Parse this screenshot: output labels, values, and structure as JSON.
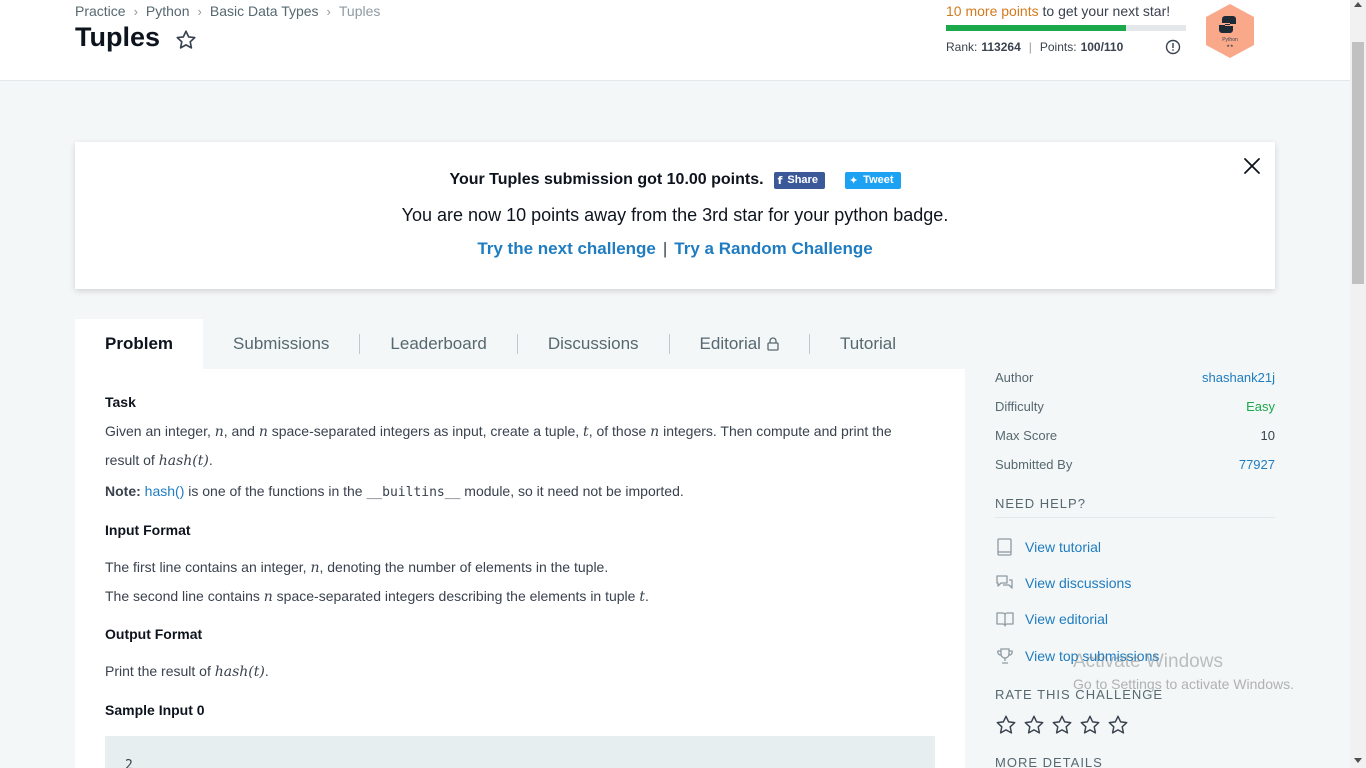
{
  "header": {
    "breadcrumb": [
      "Practice",
      "Python",
      "Basic Data Types",
      "Tuples"
    ],
    "title": "Tuples",
    "points_highlight": "10 more points",
    "points_rest": " to get your next star!",
    "progress_fraction": 0.75,
    "rank_label": "Rank:",
    "rank_value": "113264",
    "points_label": "Points:",
    "points_value": "100/110",
    "badge_label": "Python",
    "badge_stars": "★★"
  },
  "banner": {
    "message": "Your Tuples submission got 10.00 points.",
    "share_label": "Share",
    "tweet_label": "Tweet",
    "subtitle": "You are now 10 points away from the 3rd star for your python badge.",
    "next_link": "Try the next challenge",
    "separator": "|",
    "random_link": "Try a Random Challenge"
  },
  "tabs": [
    "Problem",
    "Submissions",
    "Leaderboard",
    "Discussions",
    "Editorial",
    "Tutorial"
  ],
  "problem": {
    "task_heading": "Task",
    "task_1": "Given an integer, ",
    "task_n": "n",
    "task_2": ", and ",
    "task_3": " space-separated integers as input, create a tuple, ",
    "task_t": "t",
    "task_4": ", of those ",
    "task_5": " integers. Then compute and print the",
    "task_6": "result of ",
    "hash_t": "hash(t)",
    "task_7": ".",
    "note_label": "Note:",
    "note_link": "hash()",
    "note_1": " is one of the functions in the ",
    "note_code": "__builtins__",
    "note_2": " module, so it need not be imported.",
    "input_heading": "Input Format",
    "input_1a": "The first line contains an integer, ",
    "input_1b": ", denoting the number of elements in the tuple.",
    "input_2a": "The second line contains ",
    "input_2b": " space-separated integers describing the elements in tuple ",
    "input_2c": ".",
    "output_heading": "Output Format",
    "output_1": "Print the result of ",
    "output_2": ".",
    "sample_heading": "Sample Input 0",
    "sample_first_line": "2"
  },
  "sidebar": {
    "meta": [
      {
        "key": "Author",
        "value": "shashank21j"
      },
      {
        "key": "Difficulty",
        "value": "Easy"
      },
      {
        "key": "Max Score",
        "value": "10"
      },
      {
        "key": "Submitted By",
        "value": "77927"
      }
    ],
    "need_help": "NEED HELP?",
    "help_links": [
      "View tutorial",
      "View discussions",
      "View editorial",
      "View top submissions"
    ],
    "rate_heading": "RATE THIS CHALLENGE",
    "more_details": "MORE DETAILS"
  },
  "watermark": {
    "line1": "Activate Windows",
    "line2": "Go to Settings to activate Windows."
  }
}
